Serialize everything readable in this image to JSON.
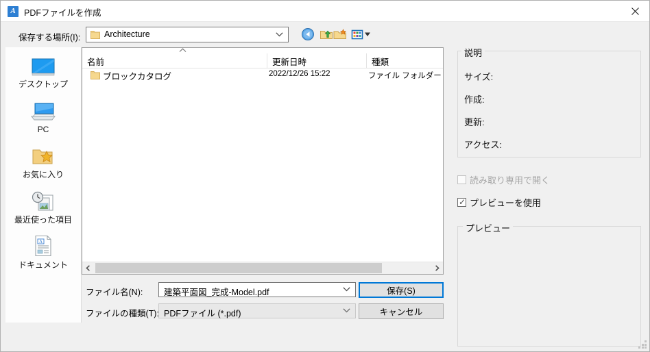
{
  "window": {
    "title": "PDFファイルを作成",
    "app_icon": "autocad-a-icon",
    "close_icon": "close-icon"
  },
  "lookin": {
    "label": "保存する場所(I):",
    "value": "Architecture",
    "folder_icon": "folder-icon",
    "chevron_icon": "chevron-down-icon"
  },
  "toolbar": {
    "back": "back-icon",
    "up": "up-folder-icon",
    "new_folder": "new-folder-icon",
    "views": "views-icon"
  },
  "places": {
    "items": [
      {
        "label": "デスクトップ",
        "icon": "desktop-icon"
      },
      {
        "label": "PC",
        "icon": "computer-icon"
      },
      {
        "label": "お気に入り",
        "icon": "favorites-folder-icon"
      },
      {
        "label": "最近使った項目",
        "icon": "recent-items-icon"
      },
      {
        "label": "ドキュメント",
        "icon": "document-icon"
      }
    ]
  },
  "filelist": {
    "columns": [
      "名前",
      "更新日時",
      "種類"
    ],
    "sort_indicator": "sort-ascending-icon",
    "rows": [
      {
        "name": "ブロックカタログ",
        "modified": "2022/12/26 15:22",
        "type": "ファイル フォルダー",
        "icon": "folder-icon"
      }
    ],
    "scrollbar": {
      "left_arrow": "chevron-left-icon",
      "right_arrow": "chevron-right-icon"
    }
  },
  "description": {
    "legend": "説明",
    "fields": [
      "サイズ:",
      "作成:",
      "更新:",
      "アクセス:"
    ]
  },
  "options": {
    "readonly": {
      "label": "読み取り専用で開く",
      "checked": false,
      "enabled": false
    },
    "preview": {
      "label": "プレビューを使用",
      "checked": true,
      "enabled": true
    }
  },
  "preview": {
    "legend": "プレビュー",
    "content": ""
  },
  "bottom": {
    "filename_label": "ファイル名(N):",
    "filename_value": "建築平面図_完成-Model.pdf",
    "filetype_label": "ファイルの種類(T):",
    "filetype_value": "PDFファイル (*.pdf)",
    "save_label": "保存(S)",
    "cancel_label": "キャンセル"
  },
  "colors": {
    "dialog_background": "#f0f0f0",
    "focus_accent": "#0078d7",
    "list_background": "#ffffff",
    "folder_yellow": "#f8d775"
  }
}
